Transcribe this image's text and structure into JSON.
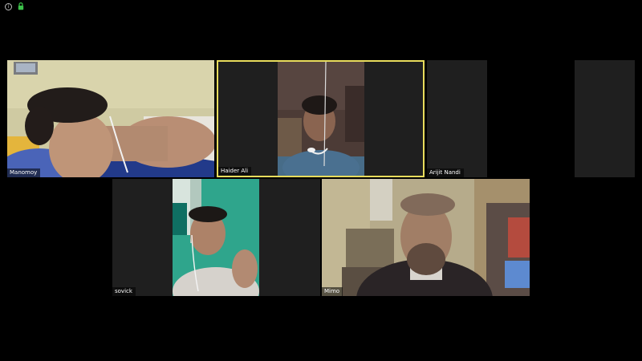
{
  "participants": [
    {
      "name": "Manomoy"
    },
    {
      "name": "Haider Ali"
    },
    {
      "name": "Arijit Nandi"
    },
    {
      "name": ""
    },
    {
      "name": "sovick"
    },
    {
      "name": "Mimo"
    }
  ],
  "colors": {
    "background": "#000000",
    "tile_empty": "#1f1f1f",
    "active_speaker_border": "#e8dc5c",
    "lock_icon": "#3cc14a"
  },
  "icons": {
    "meeting_info": "info-icon",
    "encryption": "lock-icon"
  }
}
